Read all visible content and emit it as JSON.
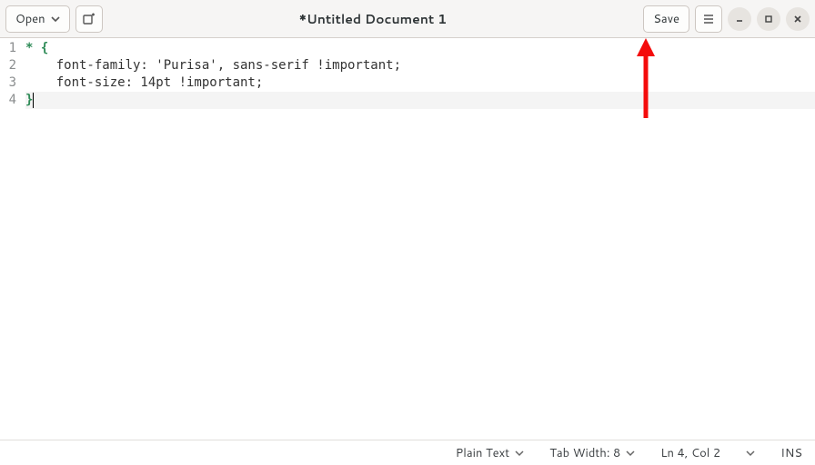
{
  "header": {
    "open_label": "Open",
    "title": "*Untitled Document 1",
    "save_label": "Save"
  },
  "code": {
    "lines": [
      {
        "n": "1",
        "segments": [
          {
            "cls": "tok-star",
            "t": "* "
          },
          {
            "cls": "tok-brace",
            "t": "{"
          }
        ]
      },
      {
        "n": "2",
        "segments": [
          {
            "cls": "tok-text",
            "t": "    font-family: 'Purisa', sans-serif !important;"
          }
        ]
      },
      {
        "n": "3",
        "segments": [
          {
            "cls": "tok-text",
            "t": "    font-size: 14pt !important;"
          }
        ]
      },
      {
        "n": "4",
        "segments": [
          {
            "cls": "tok-brace",
            "t": "}"
          }
        ],
        "current": true,
        "caret": true
      }
    ]
  },
  "statusbar": {
    "language": "Plain Text",
    "tabwidth": "Tab Width: 8",
    "position": "Ln 4, Col 2",
    "insert": "INS"
  },
  "arrow_color": "#f40c0c"
}
